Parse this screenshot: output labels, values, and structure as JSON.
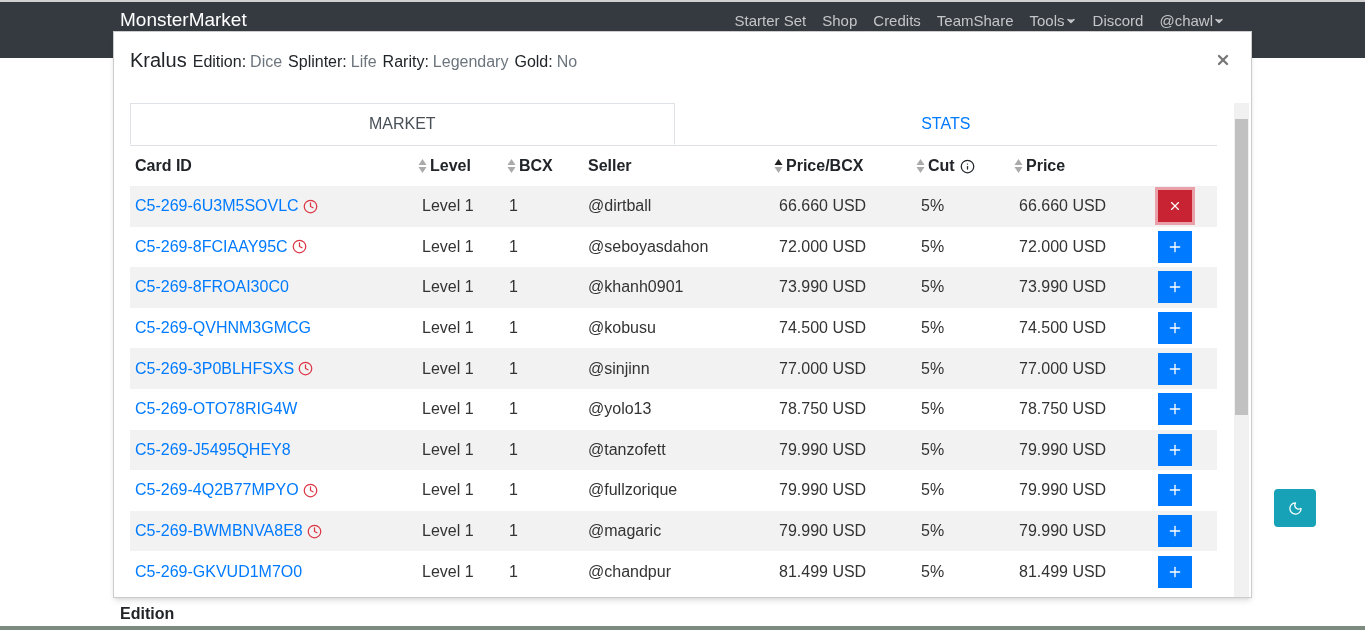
{
  "navbar": {
    "brand": "MonsterMarket",
    "links": [
      {
        "label": "Starter Set",
        "dropdown": false
      },
      {
        "label": "Shop",
        "dropdown": false
      },
      {
        "label": "Credits",
        "dropdown": false
      },
      {
        "label": "TeamShare",
        "dropdown": false
      },
      {
        "label": "Tools",
        "dropdown": true
      },
      {
        "label": "Discord",
        "dropdown": false
      },
      {
        "label": "@chawl",
        "dropdown": true
      }
    ]
  },
  "modal": {
    "title": "Kralus",
    "attributes": [
      {
        "label": "Edition:",
        "value": "Dice"
      },
      {
        "label": "Splinter:",
        "value": "Life"
      },
      {
        "label": "Rarity:",
        "value": "Legendary"
      },
      {
        "label": "Gold:",
        "value": "No"
      }
    ],
    "tabs": [
      {
        "label": "MARKET",
        "selected": true
      },
      {
        "label": "STATS",
        "selected": false
      }
    ],
    "table": {
      "columns": [
        {
          "label": "Card ID",
          "sortable": false
        },
        {
          "label": "Level",
          "sortable": true,
          "sorted_ascending": false
        },
        {
          "label": "BCX",
          "sortable": true,
          "sorted_ascending": false
        },
        {
          "label": "Seller",
          "sortable": false
        },
        {
          "label": "Price/BCX",
          "sortable": true,
          "sorted_ascending": true
        },
        {
          "label": "Cut",
          "sortable": true,
          "sorted_ascending": false,
          "info": true
        },
        {
          "label": "Price",
          "sortable": true,
          "sorted_ascending": false
        }
      ],
      "rows": [
        {
          "card_id": "C5-269-6U3M5SOVLC",
          "timer": true,
          "level": "Level 1",
          "bcx": "1",
          "seller": "@dirtball",
          "price_bcx": "66.660 USD",
          "cut": "5%",
          "price": "66.660 USD",
          "selected": true
        },
        {
          "card_id": "C5-269-8FCIAAY95C",
          "timer": true,
          "level": "Level 1",
          "bcx": "1",
          "seller": "@seboyasdahon",
          "price_bcx": "72.000 USD",
          "cut": "5%",
          "price": "72.000 USD",
          "selected": false
        },
        {
          "card_id": "C5-269-8FROAI30C0",
          "timer": false,
          "level": "Level 1",
          "bcx": "1",
          "seller": "@khanh0901",
          "price_bcx": "73.990 USD",
          "cut": "5%",
          "price": "73.990 USD",
          "selected": false
        },
        {
          "card_id": "C5-269-QVHNM3GMCG",
          "timer": false,
          "level": "Level 1",
          "bcx": "1",
          "seller": "@kobusu",
          "price_bcx": "74.500 USD",
          "cut": "5%",
          "price": "74.500 USD",
          "selected": false
        },
        {
          "card_id": "C5-269-3P0BLHFSXS",
          "timer": true,
          "level": "Level 1",
          "bcx": "1",
          "seller": "@sinjinn",
          "price_bcx": "77.000 USD",
          "cut": "5%",
          "price": "77.000 USD",
          "selected": false
        },
        {
          "card_id": "C5-269-OTO78RIG4W",
          "timer": false,
          "level": "Level 1",
          "bcx": "1",
          "seller": "@yolo13",
          "price_bcx": "78.750 USD",
          "cut": "5%",
          "price": "78.750 USD",
          "selected": false
        },
        {
          "card_id": "C5-269-J5495QHEY8",
          "timer": false,
          "level": "Level 1",
          "bcx": "1",
          "seller": "@tanzofett",
          "price_bcx": "79.990 USD",
          "cut": "5%",
          "price": "79.990 USD",
          "selected": false
        },
        {
          "card_id": "C5-269-4Q2B77MPYO",
          "timer": true,
          "level": "Level 1",
          "bcx": "1",
          "seller": "@fullzorique",
          "price_bcx": "79.990 USD",
          "cut": "5%",
          "price": "79.990 USD",
          "selected": false
        },
        {
          "card_id": "C5-269-BWMBNVA8E8",
          "timer": true,
          "level": "Level 1",
          "bcx": "1",
          "seller": "@magaric",
          "price_bcx": "79.990 USD",
          "cut": "5%",
          "price": "79.990 USD",
          "selected": false
        },
        {
          "card_id": "C5-269-GKVUD1M7O0",
          "timer": false,
          "level": "Level 1",
          "bcx": "1",
          "seller": "@chandpur",
          "price_bcx": "81.499 USD",
          "cut": "5%",
          "price": "81.499 USD",
          "selected": false
        }
      ]
    }
  },
  "page": {
    "section_heading": "Edition"
  }
}
